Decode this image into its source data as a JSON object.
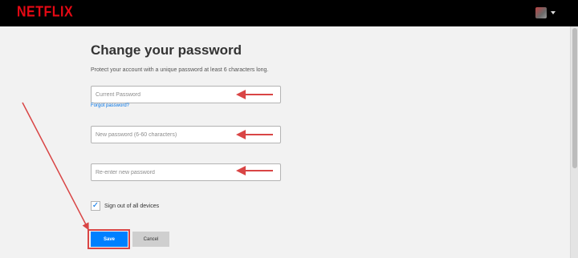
{
  "header": {
    "logo": "NETFLIX"
  },
  "form": {
    "title": "Change your password",
    "description": "Protect your account with a unique password at least 6 characters long.",
    "current_placeholder": "Current Password",
    "forgot_label": "Forgot password?",
    "new_placeholder": "New password (6-60 characters)",
    "reenter_placeholder": "Re-enter new password",
    "signout_label": "Sign out of all devices",
    "signout_checked": true,
    "save_label": "Save",
    "cancel_label": "Cancel"
  },
  "colors": {
    "brand": "#e50914",
    "primary_button": "#0080ff",
    "annotation": "#d94545"
  },
  "icons": {
    "profile": "profile-avatar-icon",
    "caret": "caret-down-icon",
    "checkmark": "checkmark-icon"
  }
}
